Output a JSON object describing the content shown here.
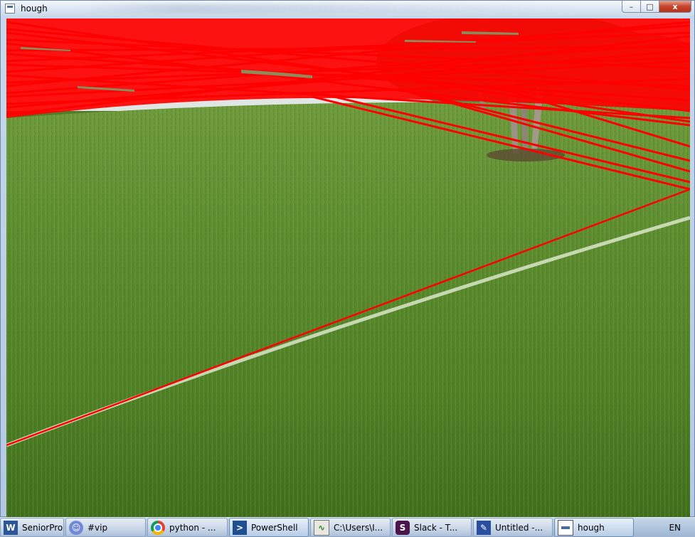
{
  "window": {
    "title": "hough",
    "controls": {
      "minimize": "–",
      "maximize": "□",
      "close": "x"
    }
  },
  "image": {
    "description_icon": "hough-lines-lawn-image",
    "line_color": "#ff0000",
    "grass_color": "#5a8a2e",
    "sky_color": "#dfe6e4"
  },
  "taskbar": {
    "items": [
      {
        "label": "SeniorPro...",
        "icon": "document-icon",
        "active": false
      },
      {
        "label": "#vip",
        "icon": "discord-icon",
        "active": false
      },
      {
        "label": "python - ...",
        "icon": "chrome-icon",
        "active": false
      },
      {
        "label": "PowerShell",
        "icon": "powershell-icon",
        "active": true
      },
      {
        "label": "C:\\Users\\I...",
        "icon": "resource-monitor-icon",
        "active": false
      },
      {
        "label": "Slack - T...",
        "icon": "slack-icon",
        "active": false
      },
      {
        "label": "Untitled -...",
        "icon": "paint-icon",
        "active": false
      },
      {
        "label": "hough",
        "icon": "window-icon",
        "active": true
      }
    ],
    "tray": {
      "language": "EN"
    }
  }
}
